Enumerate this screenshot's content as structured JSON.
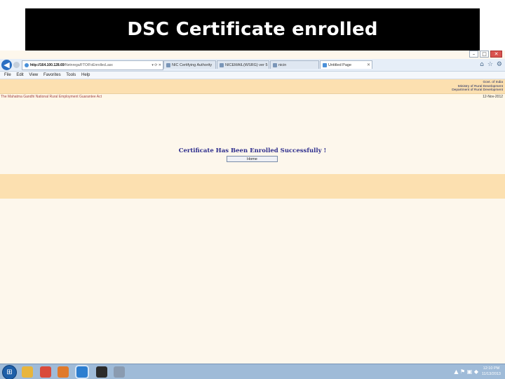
{
  "slide": {
    "title": "DSC Certificate enrolled"
  },
  "browser": {
    "address": {
      "host": "http://164.100.128.69",
      "path": "/Netnrega/FTO/FoEnrollecLasx",
      "tools": "▾ ⟳ ✕"
    },
    "tabs": [
      {
        "label": "NIC Certifying Authority"
      },
      {
        "label": "NICEMAIL(WSRG) ver 5"
      },
      {
        "label": "nicin"
      },
      {
        "label": "Untitled Page"
      }
    ],
    "menu": [
      "File",
      "Edit",
      "View",
      "Favorites",
      "Tools",
      "Help"
    ],
    "window_controls": {
      "minimize": "–",
      "maximize": "□",
      "close": "✕"
    },
    "toolbar_icons": {
      "home": "⌂",
      "favorites": "☆",
      "settings": "⚙"
    }
  },
  "page": {
    "gov_lines": [
      "Govt. of India",
      "Ministry of Rural Development",
      "Department of Rural Development"
    ],
    "act_name": "The Mahatma Gandhi National Rural Employment Guarantee Act",
    "date": "12-Nov-2012",
    "message": "Certificate Has Been Enrolled Successfully !",
    "home_button": "Home"
  },
  "taskbar": {
    "apps": [
      {
        "name": "folder",
        "color": "#e8b53c"
      },
      {
        "name": "chrome",
        "color": "#d94b3b"
      },
      {
        "name": "media",
        "color": "#e07a2c"
      },
      {
        "name": "ie",
        "color": "#2d7ed0",
        "active": true
      },
      {
        "name": "pdf",
        "color": "#2b2b2b"
      },
      {
        "name": "other",
        "color": "#8a9bb0"
      }
    ],
    "tray": "▲ ⚑ ▣ ◆",
    "time": "12:10 PM",
    "date": "11/13/2013"
  },
  "colors": {
    "header_band": "#fce0b0",
    "page_bg": "#fdf7ec",
    "message_color": "#2c2c8c",
    "title_bg": "#000000"
  }
}
